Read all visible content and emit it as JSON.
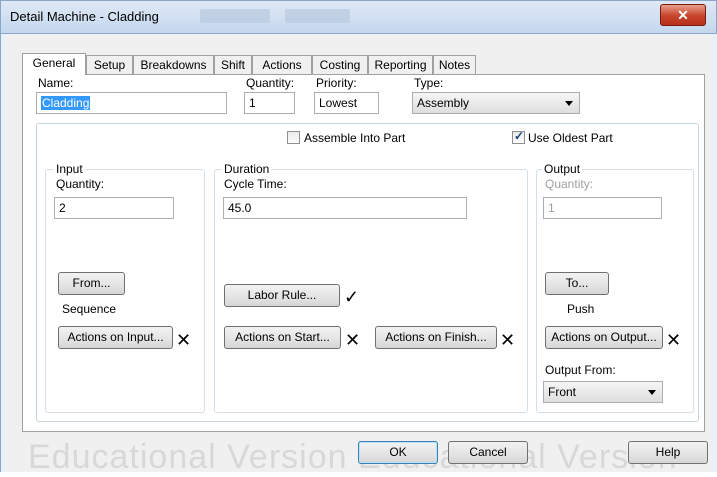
{
  "window": {
    "title": "Detail Machine - Cladding",
    "close_glyph": "✕"
  },
  "tabs": [
    {
      "label": "General",
      "active": true
    },
    {
      "label": "Setup"
    },
    {
      "label": "Breakdowns"
    },
    {
      "label": "Shift"
    },
    {
      "label": "Actions"
    },
    {
      "label": "Costing"
    },
    {
      "label": "Reporting"
    },
    {
      "label": "Notes"
    }
  ],
  "general": {
    "name_label": "Name:",
    "name_value": "Cladding",
    "quantity_label": "Quantity:",
    "quantity_value": "1",
    "priority_label": "Priority:",
    "priority_value": "Lowest",
    "type_label": "Type:",
    "type_value": "Assembly",
    "assemble_into_part_label": "Assemble Into Part",
    "assemble_into_part_checked": false,
    "use_oldest_part_label": "Use Oldest Part",
    "use_oldest_part_checked": true
  },
  "input": {
    "group_label": "Input",
    "quantity_label": "Quantity:",
    "quantity_value": "2",
    "from_button": "From...",
    "from_value": "Sequence",
    "actions_button": "Actions on Input...",
    "actions_mark": "✕"
  },
  "duration": {
    "group_label": "Duration",
    "cycle_time_label": "Cycle Time:",
    "cycle_time_value": "45.0",
    "labor_rule_button": "Labor Rule...",
    "labor_rule_mark": "✓",
    "actions_start_button": "Actions on Start...",
    "actions_start_mark": "✕",
    "actions_finish_button": "Actions on Finish...",
    "actions_finish_mark": "✕"
  },
  "output": {
    "group_label": "Output",
    "quantity_label": "Quantity:",
    "quantity_value": "1",
    "to_button": "To...",
    "to_value": "Push",
    "actions_button": "Actions on Output...",
    "actions_mark": "✕",
    "output_from_label": "Output From:",
    "output_from_value": "Front"
  },
  "footer": {
    "ok_button": "OK",
    "cancel_button": "Cancel",
    "help_button": "Help",
    "watermark": "Educational Version   Educational Version"
  }
}
